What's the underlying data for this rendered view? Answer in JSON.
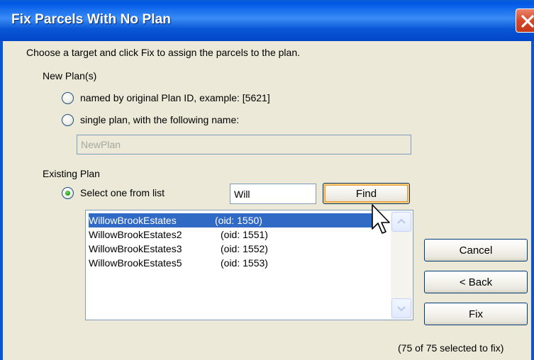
{
  "window": {
    "title": "Fix Parcels With No Plan"
  },
  "instructions": "Choose a target and click Fix to assign the parcels to the plan.",
  "new_plans": {
    "heading": "New Plan(s)",
    "option_original": "named by original Plan ID, example: [5621]",
    "option_single": "single plan, with the following name:",
    "single_name_value": "NewPlan"
  },
  "existing_plan": {
    "heading": "Existing Plan",
    "option_select": "Select one from list",
    "search_value": "Will",
    "find_label": "Find",
    "list": [
      {
        "name": "WillowBrookEstates",
        "oid": "(oid: 1550)",
        "selected": true
      },
      {
        "name": "WillowBrookEstates2",
        "oid": "(oid: 1551)",
        "selected": false
      },
      {
        "name": "WillowBrookEstates3",
        "oid": "(oid: 1552)",
        "selected": false
      },
      {
        "name": "WillowBrookEstates5",
        "oid": "(oid: 1553)",
        "selected": false
      }
    ]
  },
  "buttons": {
    "cancel": "Cancel",
    "back": "< Back",
    "fix": "Fix"
  },
  "status": "(75 of 75 selected to fix)",
  "colors": {
    "title_bar": "#0058e6",
    "selection": "#316ac5",
    "dialog_bg": "#ece9d8",
    "radio_dot": "#22a61c"
  }
}
